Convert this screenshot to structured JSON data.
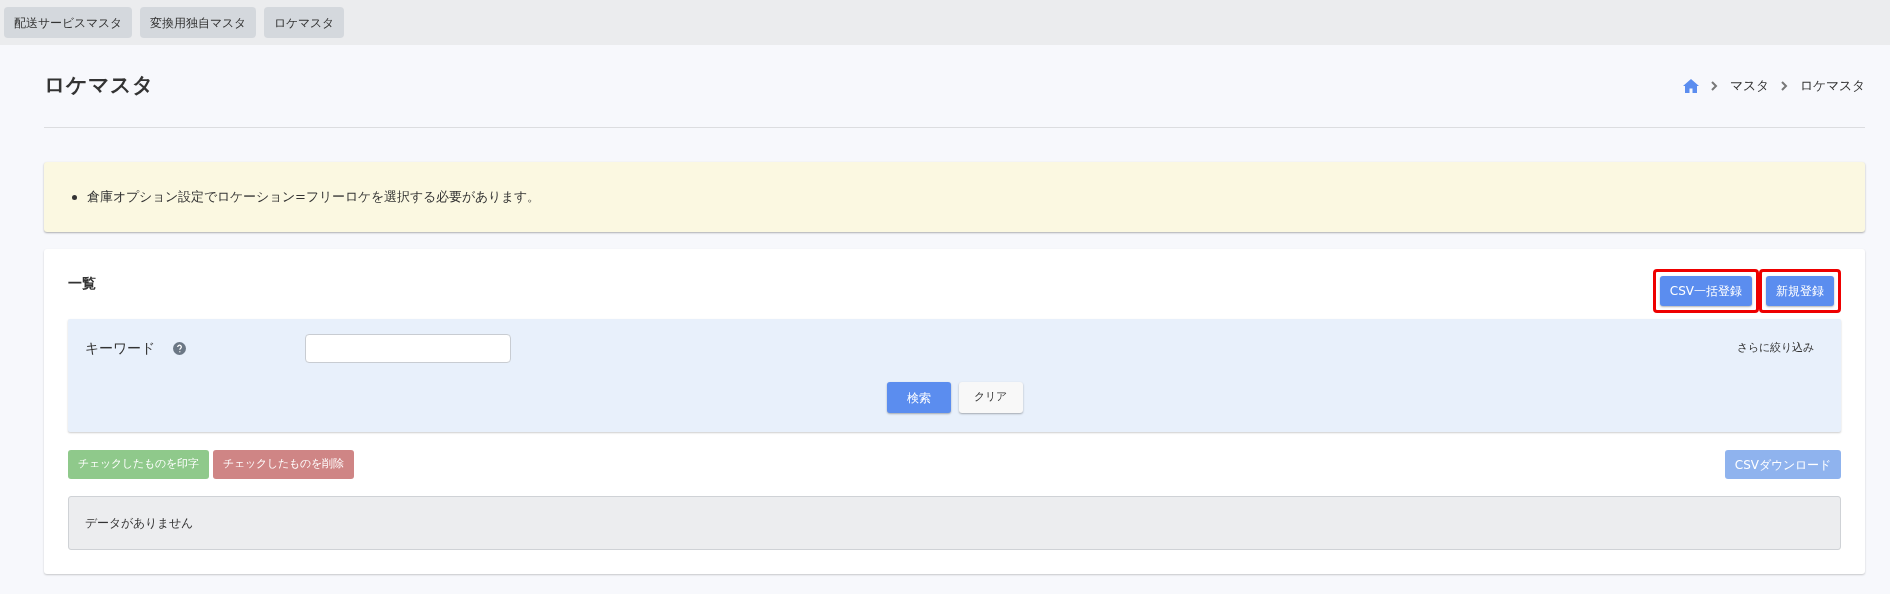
{
  "top_tabs": [
    {
      "label": "配送サービスマスタ"
    },
    {
      "label": "変換用独自マスタ"
    },
    {
      "label": "ロケマスタ"
    }
  ],
  "page_title": "ロケマスタ",
  "breadcrumb": [
    "マスタ",
    "ロケマスタ"
  ],
  "notice": [
    "倉庫オプション設定でロケーション=フリーロケを選択する必要があります。"
  ],
  "list": {
    "title": "一覧",
    "header_buttons": [
      {
        "label": "CSV一括登録",
        "highlighted": true
      },
      {
        "label": "新規登録",
        "highlighted": true
      }
    ],
    "filter": {
      "keyword_label": "キーワード",
      "more_filters": "さらに絞り込み",
      "search_button": "検索",
      "clear_button": "クリア"
    },
    "actions": [
      {
        "label": "チェックしたものを印字",
        "kind": "print",
        "disabled": true
      },
      {
        "label": "チェックしたものを削除",
        "kind": "delete",
        "disabled": true
      }
    ],
    "csv_download": {
      "label": "CSVダウンロード",
      "disabled": true
    },
    "empty_message": "データがありません"
  }
}
